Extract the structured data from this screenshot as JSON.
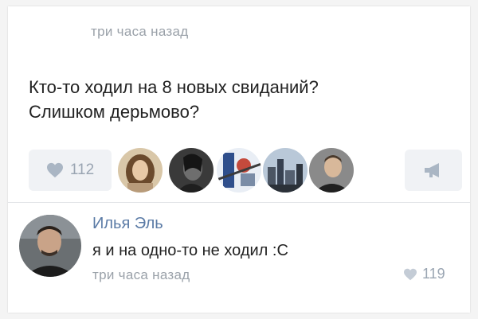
{
  "post": {
    "time": "три часа назад",
    "text_line1": "Кто-то ходил на 8 новых свиданий?",
    "text_line2": "Слишком дерьмово?",
    "likes": "112"
  },
  "likers": [
    {
      "icon": "woman-portrait-avatar"
    },
    {
      "icon": "dark-portrait-avatar"
    },
    {
      "icon": "abstract-pattern-avatar"
    },
    {
      "icon": "city-skyline-avatar"
    },
    {
      "icon": "man-portrait-avatar"
    }
  ],
  "comment": {
    "author": "Илья Эль",
    "text": "я и на одно-то не ходил :С",
    "time": "три часа назад",
    "likes": "119"
  },
  "colors": {
    "link": "#5b7ba6",
    "muted": "#9aa1a9",
    "button_bg": "#f0f2f5",
    "icon": "#aab6c4"
  }
}
